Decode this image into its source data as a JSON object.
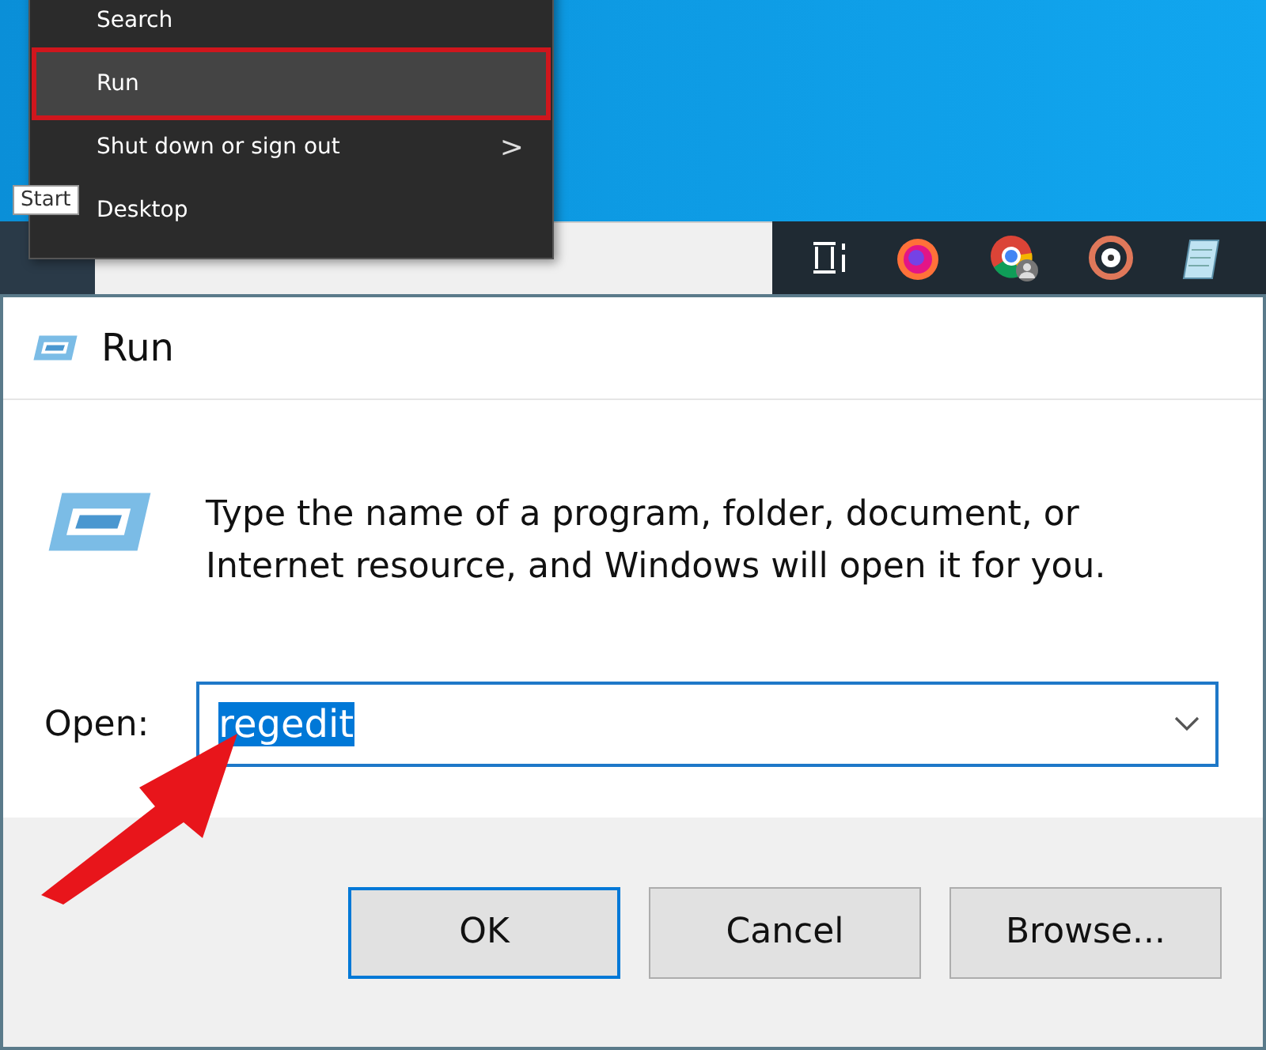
{
  "start_menu": {
    "items": [
      {
        "label": "Search",
        "kind": "plain",
        "selected": false,
        "annotated": false
      },
      {
        "label": "Run",
        "kind": "plain",
        "selected": true,
        "annotated": true
      },
      {
        "label": "Shut down or sign out",
        "kind": "submenu",
        "selected": false,
        "annotated": false,
        "arrow": ">"
      },
      {
        "label": "Desktop",
        "kind": "plain",
        "selected": false,
        "annotated": false
      }
    ]
  },
  "tooltip": "Start",
  "taskbar": {
    "icons": [
      {
        "kind": "task-view"
      },
      {
        "kind": "firefox"
      },
      {
        "kind": "chrome"
      },
      {
        "kind": "disc"
      },
      {
        "kind": "notepad"
      }
    ]
  },
  "dialog": {
    "title": "Run",
    "description": "Type the name of a program, folder, document, or Internet resource, and Windows will open it for you.",
    "open_label": "Open:",
    "open_value": "regedit",
    "value_selected": true,
    "buttons": [
      {
        "label": "OK",
        "default": true
      },
      {
        "label": "Cancel",
        "default": false
      },
      {
        "label": "Browse...",
        "default": false
      }
    ]
  },
  "annotation_arrow": true
}
